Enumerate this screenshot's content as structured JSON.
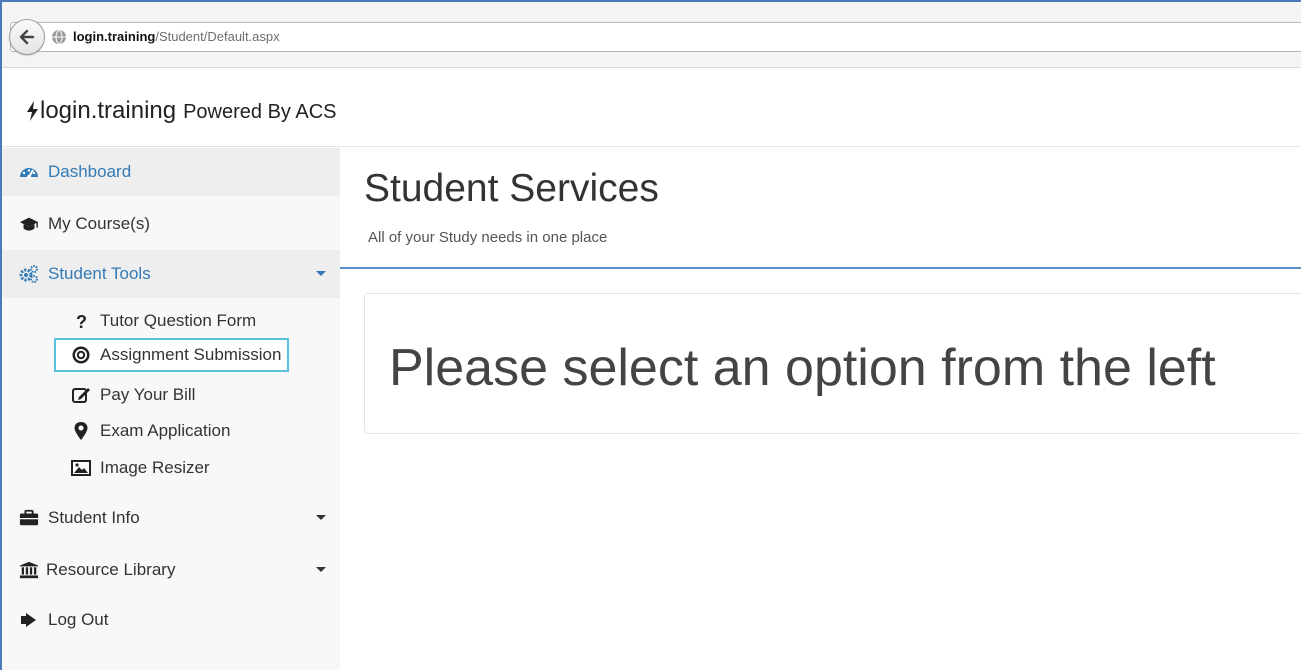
{
  "browser": {
    "url_domain": "login.training",
    "url_path": "/Student/Default.aspx"
  },
  "brand": {
    "name": "login.training",
    "powered": "Powered By ACS"
  },
  "sidebar": {
    "items": [
      {
        "label": "Dashboard",
        "icon": "dashboard-icon",
        "state": "active"
      },
      {
        "label": "My Course(s)",
        "icon": "graduation-cap-icon"
      },
      {
        "label": "Student Tools",
        "icon": "cogs-icon",
        "state": "expanded",
        "children": [
          {
            "label": "Tutor Question Form",
            "icon": "question-icon"
          },
          {
            "label": "Assignment Submission",
            "icon": "bullseye-icon",
            "state": "highlighted"
          },
          {
            "label": "Pay Your Bill",
            "icon": "edit-icon"
          },
          {
            "label": "Exam Application",
            "icon": "map-marker-icon"
          },
          {
            "label": "Image Resizer",
            "icon": "picture-icon"
          }
        ]
      },
      {
        "label": "Student Info",
        "icon": "briefcase-icon"
      },
      {
        "label": "Resource Library",
        "icon": "bank-icon"
      },
      {
        "label": "Log Out",
        "icon": "sign-out-icon"
      }
    ]
  },
  "main": {
    "title": "Student Services",
    "subtitle": "All of your Study needs in one place",
    "message": "Please select an option from the left"
  },
  "colors": {
    "accent": "#337ab7",
    "highlight_border": "#5bc0de",
    "title_rule": "#5b8fc7",
    "sidebar_bg": "#f8f8f8"
  }
}
